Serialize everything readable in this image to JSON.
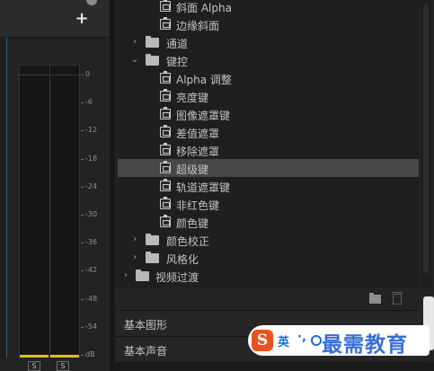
{
  "meter_panel": {
    "add_label": "+",
    "db_scale": [
      "0",
      "-6",
      "-12",
      "-18",
      "-24",
      "-30",
      "-36",
      "-42",
      "-48",
      "-54",
      "dB"
    ],
    "solo_buttons": [
      "S",
      "S"
    ]
  },
  "effects": {
    "tree": [
      {
        "kind": "effect",
        "indent": 1,
        "label": "斜面 Alpha"
      },
      {
        "kind": "effect",
        "indent": 1,
        "label": "边缘斜面"
      },
      {
        "kind": "folder",
        "indent": 0,
        "expanded": false,
        "label": "通道"
      },
      {
        "kind": "folder",
        "indent": 0,
        "expanded": true,
        "label": "键控"
      },
      {
        "kind": "effect",
        "indent": 1,
        "label": "Alpha 调整"
      },
      {
        "kind": "effect",
        "indent": 1,
        "label": "亮度键"
      },
      {
        "kind": "effect",
        "indent": 1,
        "label": "图像遮罩键"
      },
      {
        "kind": "effect",
        "indent": 1,
        "label": "差值遮罩"
      },
      {
        "kind": "effect",
        "indent": 1,
        "label": "移除遮罩"
      },
      {
        "kind": "effect",
        "indent": 1,
        "label": "超级键",
        "selected": true
      },
      {
        "kind": "effect",
        "indent": 1,
        "label": "轨道遮罩键"
      },
      {
        "kind": "effect",
        "indent": 1,
        "label": "非红色键"
      },
      {
        "kind": "effect",
        "indent": 1,
        "label": "颜色键"
      },
      {
        "kind": "folder",
        "indent": 0,
        "expanded": false,
        "label": "颜色校正"
      },
      {
        "kind": "folder",
        "indent": 0,
        "expanded": false,
        "label": "风格化"
      },
      {
        "kind": "folder",
        "indent": -1,
        "expanded": false,
        "label": "视频过渡"
      }
    ],
    "sections": [
      "基本图形",
      "基本声音"
    ]
  },
  "ime": {
    "logo": "S",
    "mode": "英",
    "punct": "·,"
  },
  "watermark": "最需教育",
  "colors": {
    "selected_row": "#474747",
    "meter_level": "#d8c21a",
    "watermark": "#3a6fd8",
    "ime_logo": "#e8531f"
  }
}
